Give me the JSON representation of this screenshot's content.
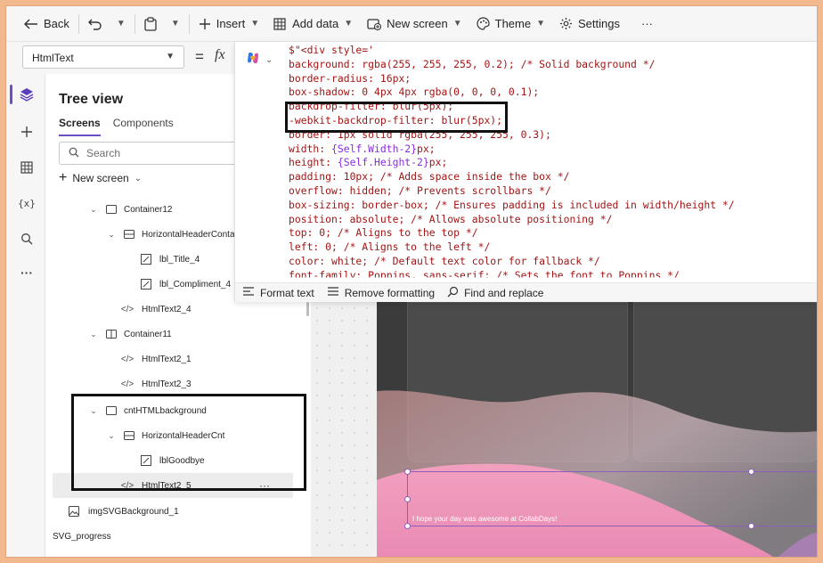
{
  "commandbar": {
    "back": "Back",
    "insert": "Insert",
    "add_data": "Add data",
    "new_screen": "New screen",
    "theme": "Theme",
    "settings": "Settings",
    "more": "···"
  },
  "formula": {
    "property": "HtmlText",
    "equals": "=",
    "fx": "fx"
  },
  "tree": {
    "title": "Tree view",
    "tabs": [
      "Screens",
      "Components"
    ],
    "search_placeholder": "Search",
    "new_screen": "New screen",
    "items": [
      {
        "label": "Container12"
      },
      {
        "label": "HorizontalHeaderContair"
      },
      {
        "label": "lbl_Title_4"
      },
      {
        "label": "lbl_Compliment_4"
      },
      {
        "label": "HtmlText2_4"
      },
      {
        "label": "Container11"
      },
      {
        "label": "HtmlText2_1"
      },
      {
        "label": "HtmlText2_3"
      },
      {
        "label": "cntHTMLbackground"
      },
      {
        "label": "HorizontalHeaderCnt"
      },
      {
        "label": "lblGoodbye"
      },
      {
        "label": "HtmlText2_5",
        "more": "···"
      },
      {
        "label": "imgSVGBackground_1"
      },
      {
        "label": "SVG_progress"
      }
    ]
  },
  "code": {
    "lines": [
      "$\"<div style='",
      "background: rgba(255, 255, 255, 0.2); /* Solid background */",
      "border-radius: 16px;",
      "box-shadow: 0 4px 4px rgba(0, 0, 0, 0.1);",
      "backdrop-filter: blur(5px);",
      "-webkit-backdrop-filter: blur(5px);",
      "border: 1px solid rgba(255, 255, 255, 0.3);",
      "width: {Self.Width-2}px;",
      "height: {Self.Height-2}px;",
      "padding: 10px; /* Adds space inside the box */",
      "overflow: hidden; /* Prevents scrollbars */",
      "box-sizing: border-box; /* Ensures padding is included in width/height */",
      "position: absolute; /* Allows absolute positioning */",
      "top: 0; /* Aligns to the top */",
      "left: 0; /* Aligns to the left */",
      "color: white; /* Default text color for fallback */",
      "font-family: Poppins, sans-serif; /* Sets the font to Poppins */"
    ],
    "expr_width": "{Self.Width-2}",
    "expr_height": "{Self.Height-2}"
  },
  "editor_toolbar": {
    "format_text": "Format text",
    "remove_formatting": "Remove formatting",
    "find_replace": "Find and replace"
  },
  "canvas": {
    "label_text": "I hope your day was awesome at CollabDays!"
  },
  "colors": {
    "accent": "#6b4fc7",
    "code_text": "#a31515",
    "code_expr": "#8a2be2",
    "pink": "#f4a6c4"
  }
}
